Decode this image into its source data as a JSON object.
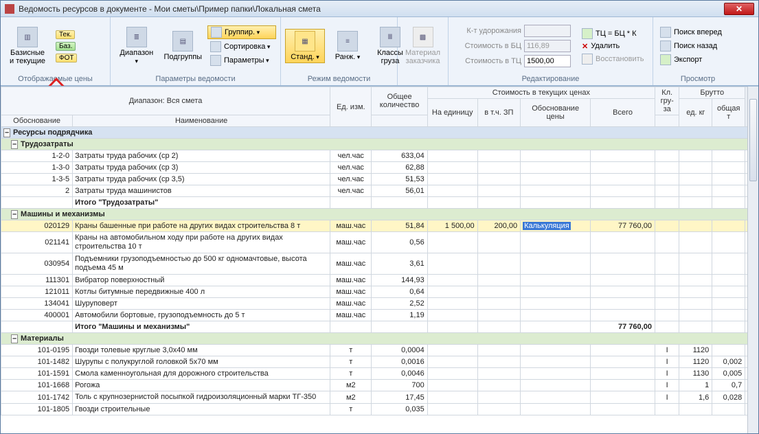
{
  "titlebar": {
    "text": "Ведомость ресурсов в документе - Мои сметы\\Пример папки\\Локальная смета"
  },
  "ribbon": {
    "g1": {
      "label": "Отображаемые цены",
      "big": "Базисные\nи текущие",
      "tek": "Тек.",
      "baz": "Баз.",
      "fot": "ФОТ"
    },
    "g2": {
      "label": "Параметры ведомости",
      "range": "Диапазон",
      "sub": "Подгруппы",
      "grp": "Группир.",
      "sort": "Сортировка",
      "param": "Параметры"
    },
    "g3": {
      "label": "Режим ведомости",
      "std": "Станд.",
      "rang": "Ранж.",
      "klass": "Классы\nгруза"
    },
    "g4": {
      "label": "",
      "mz": "Материал\nзаказчика"
    },
    "g5": {
      "label": "Редактирование",
      "k": "К-т удорожания",
      "bc": "Стоимость в БЦ",
      "bcv": "116,89",
      "tc": "Стоимость в ТЦ",
      "tcv": "1500,00",
      "formula": "ТЦ = БЦ * К",
      "del": "Удалить",
      "rest": "Восстановить"
    },
    "g6": {
      "label": "Просмотр",
      "f": "Поиск вперед",
      "b": "Поиск назад",
      "e": "Экспорт"
    }
  },
  "headers": {
    "range_caption": "Диапазон: Вся смета",
    "qty": "Общее количество",
    "tekprices": "Стоимость в текущих ценах",
    "just": "Обоснование",
    "name": "Наименование",
    "unit": "Ед. изм.",
    "unitprice": "На единицу",
    "zp": "в т.ч. ЗП",
    "basis": "Обоснование цены",
    "total": "Всего",
    "klg": "Кл. гру-за",
    "brutto": "Брутто",
    "ekg": "ед. кг",
    "okg": "общая т"
  },
  "sections": {
    "root": "Ресурсы подрядчика",
    "s1": "Трудозатраты",
    "s1t": "Итого \"Трудозатраты\"",
    "s2": "Машины и механизмы",
    "s2t": "Итого \"Машины и механизмы\"",
    "s3": "Материалы"
  },
  "rows": {
    "r1": {
      "c": "1-2-0",
      "n": "Затраты труда рабочих (ср 2)",
      "u": "чел.час",
      "q": "633,04"
    },
    "r2": {
      "c": "1-3-0",
      "n": "Затраты труда рабочих (ср 3)",
      "u": "чел.час",
      "q": "62,88"
    },
    "r3": {
      "c": "1-3-5",
      "n": "Затраты труда рабочих (ср 3,5)",
      "u": "чел.час",
      "q": "51,53"
    },
    "r4": {
      "c": "2",
      "n": "Затраты труда машинистов",
      "u": "чел.час",
      "q": "56,01"
    },
    "m1": {
      "c": "020129",
      "n": "Краны башенные при работе на других видах строительства 8 т",
      "u": "маш.час",
      "q": "51,84",
      "up": "1 500,00",
      "zp": "200,00",
      "b": "Калькуляция",
      "t": "77 760,00"
    },
    "m2": {
      "c": "021141",
      "n": "Краны на автомобильном ходу при работе на других видах строительства 10 т",
      "u": "маш.час",
      "q": "0,56"
    },
    "m3": {
      "c": "030954",
      "n": "Подъемники грузоподъемностью до 500 кг одномачтовые, высота подъема 45 м",
      "u": "маш.час",
      "q": "3,61"
    },
    "m4": {
      "c": "111301",
      "n": "Вибратор поверхностный",
      "u": "маш.час",
      "q": "144,93"
    },
    "m5": {
      "c": "121011",
      "n": "Котлы битумные передвижные 400 л",
      "u": "маш.час",
      "q": "0,64"
    },
    "m6": {
      "c": "134041",
      "n": "Шуруповерт",
      "u": "маш.час",
      "q": "2,52"
    },
    "m7": {
      "c": "400001",
      "n": "Автомобили бортовые, грузоподъемность до 5 т",
      "u": "маш.час",
      "q": "1,19"
    },
    "s2t": "77 760,00",
    "t1": {
      "c": "101-0195",
      "n": "Гвозди толевые круглые 3,0х40 мм",
      "u": "т",
      "q": "0,0004",
      "kg": "I",
      "ekg": "1120"
    },
    "t2": {
      "c": "101-1482",
      "n": "Шурупы с полукруглой головкой 5х70 мм",
      "u": "т",
      "q": "0,0016",
      "kg": "I",
      "ekg": "1120",
      "okg": "0,002"
    },
    "t3": {
      "c": "101-1591",
      "n": "Смола каменноугольная для дорожного строительства",
      "u": "т",
      "q": "0,0046",
      "kg": "I",
      "ekg": "1130",
      "okg": "0,005"
    },
    "t4": {
      "c": "101-1668",
      "n": "Рогожа",
      "u": "м2",
      "q": "700",
      "kg": "I",
      "ekg": "1",
      "okg": "0,7"
    },
    "t5": {
      "c": "101-1742",
      "n": "Толь с крупнозернистой посыпкой гидроизоляционный марки ТГ-350",
      "u": "м2",
      "q": "17,45",
      "kg": "I",
      "ekg": "1,6",
      "okg": "0,028"
    },
    "t6": {
      "c": "101-1805",
      "n": "Гвозди строительные",
      "u": "т",
      "q": "0,035"
    }
  }
}
